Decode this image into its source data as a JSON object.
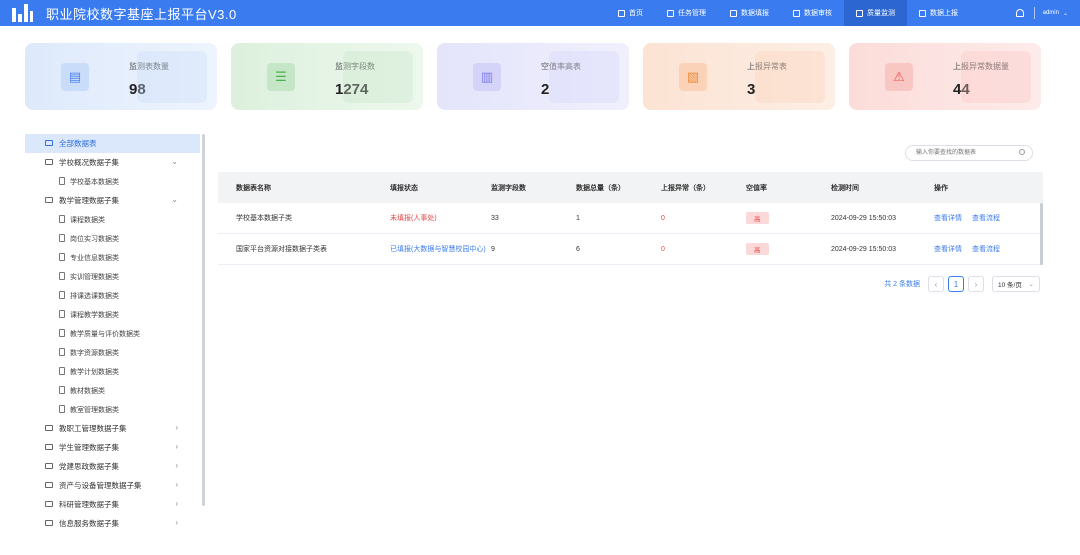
{
  "header": {
    "title": "职业院校数字基座上报平台V3.0",
    "nav": [
      {
        "label": "首页",
        "icon": "home-icon"
      },
      {
        "label": "任务管理",
        "icon": "task-icon"
      },
      {
        "label": "数据填报",
        "icon": "form-icon"
      },
      {
        "label": "数据审核",
        "icon": "audit-icon"
      },
      {
        "label": "质量监测",
        "icon": "monitor-icon",
        "active": true
      },
      {
        "label": "数据上报",
        "icon": "upload-icon"
      }
    ],
    "user": "admin"
  },
  "stats": [
    {
      "label": "监测表数量",
      "value": "98",
      "color": "#4a86f0",
      "bg": "#e3eefc"
    },
    {
      "label": "监测字段数",
      "value": "1274",
      "color": "#4caf50",
      "bg": "#e2f3e3"
    },
    {
      "label": "空值率高表",
      "value": "2",
      "color": "#7e7cf0",
      "bg": "#ebebfd"
    },
    {
      "label": "上报异常表",
      "value": "3",
      "color": "#f08c3a",
      "bg": "#fde9dc"
    },
    {
      "label": "上报异常数据量",
      "value": "44",
      "color": "#ef5350",
      "bg": "#fde5e3"
    }
  ],
  "sidebar": {
    "items": [
      {
        "label": "全部数据表",
        "type": "root",
        "active": true
      },
      {
        "label": "学校概况数据子集",
        "type": "group",
        "arrow": "⌄"
      },
      {
        "label": "学校基本数据类",
        "type": "child"
      },
      {
        "label": "教学管理数据子集",
        "type": "group",
        "arrow": "⌄"
      },
      {
        "label": "课程数据类",
        "type": "child"
      },
      {
        "label": "岗位实习数据类",
        "type": "child"
      },
      {
        "label": "专业信息数据类",
        "type": "child"
      },
      {
        "label": "实训管理数据类",
        "type": "child"
      },
      {
        "label": "排课选课数据类",
        "type": "child"
      },
      {
        "label": "课程教学数据类",
        "type": "child"
      },
      {
        "label": "教学质量与评价数据类",
        "type": "child"
      },
      {
        "label": "数字资源数据类",
        "type": "child"
      },
      {
        "label": "教学计划数据类",
        "type": "child"
      },
      {
        "label": "教材数据类",
        "type": "child"
      },
      {
        "label": "教室管理数据类",
        "type": "child"
      },
      {
        "label": "教职工管理数据子集",
        "type": "group",
        "arrow": "›"
      },
      {
        "label": "学生管理数据子集",
        "type": "group",
        "arrow": "›"
      },
      {
        "label": "党建思政数据子集",
        "type": "group",
        "arrow": "›"
      },
      {
        "label": "资产与设备管理数据子集",
        "type": "group",
        "arrow": "›"
      },
      {
        "label": "科研管理数据子集",
        "type": "group",
        "arrow": "›"
      },
      {
        "label": "信息服务数据子集",
        "type": "group",
        "arrow": "›"
      }
    ]
  },
  "search": {
    "placeholder": "输入你要查找的数据表"
  },
  "table": {
    "headers": [
      "数据表名称",
      "填报状态",
      "监测字段数",
      "数据总量（条）",
      "上报异常（条）",
      "空值率",
      "检测时间",
      "操作"
    ],
    "rows": [
      {
        "name": "学校基本数据子类",
        "status": "未填报(人事处)",
        "status_type": "red",
        "fields": "33",
        "total": "1",
        "exceptions": "0",
        "null_rate": "高",
        "time": "2024-09-29 15:50:03",
        "action1": "查看详情",
        "action2": "查看流程"
      },
      {
        "name": "国家平台资源对接数据子类表",
        "status": "已填报(大数据与智慧校园中心)",
        "status_type": "blue",
        "fields": "9",
        "total": "6",
        "exceptions": "0",
        "null_rate": "高",
        "time": "2024-09-29 15:50:03",
        "action1": "查看详情",
        "action2": "查看流程"
      }
    ]
  },
  "pagination": {
    "total_text": "共 2 条数据",
    "prev": "‹",
    "current": "1",
    "next": "›",
    "page_size": "10 条/页",
    "dropdown": "⌄"
  }
}
